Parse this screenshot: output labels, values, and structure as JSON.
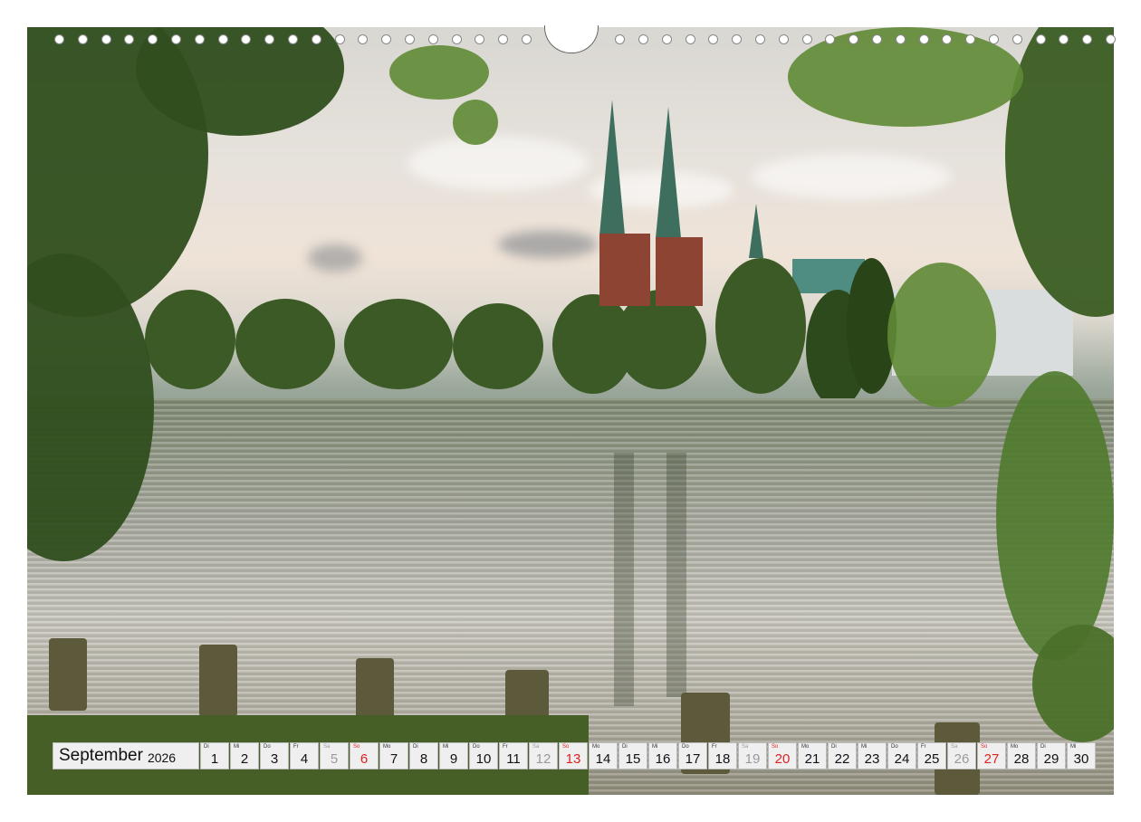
{
  "calendar": {
    "month": "September",
    "year": "2026",
    "days": [
      {
        "wd": "Di",
        "num": "1",
        "type": "weekday"
      },
      {
        "wd": "Mi",
        "num": "2",
        "type": "weekday"
      },
      {
        "wd": "Do",
        "num": "3",
        "type": "weekday"
      },
      {
        "wd": "Fr",
        "num": "4",
        "type": "weekday"
      },
      {
        "wd": "Sa",
        "num": "5",
        "type": "sat"
      },
      {
        "wd": "So",
        "num": "6",
        "type": "sun"
      },
      {
        "wd": "Mo",
        "num": "7",
        "type": "weekday"
      },
      {
        "wd": "Di",
        "num": "8",
        "type": "weekday"
      },
      {
        "wd": "Mi",
        "num": "9",
        "type": "weekday"
      },
      {
        "wd": "Do",
        "num": "10",
        "type": "weekday"
      },
      {
        "wd": "Fr",
        "num": "11",
        "type": "weekday"
      },
      {
        "wd": "Sa",
        "num": "12",
        "type": "sat"
      },
      {
        "wd": "So",
        "num": "13",
        "type": "sun"
      },
      {
        "wd": "Mo",
        "num": "14",
        "type": "weekday"
      },
      {
        "wd": "Di",
        "num": "15",
        "type": "weekday"
      },
      {
        "wd": "Mi",
        "num": "16",
        "type": "weekday"
      },
      {
        "wd": "Do",
        "num": "17",
        "type": "weekday"
      },
      {
        "wd": "Fr",
        "num": "18",
        "type": "weekday"
      },
      {
        "wd": "Sa",
        "num": "19",
        "type": "sat"
      },
      {
        "wd": "So",
        "num": "20",
        "type": "sun"
      },
      {
        "wd": "Mo",
        "num": "21",
        "type": "weekday"
      },
      {
        "wd": "Di",
        "num": "22",
        "type": "weekday"
      },
      {
        "wd": "Mi",
        "num": "23",
        "type": "weekday"
      },
      {
        "wd": "Do",
        "num": "24",
        "type": "weekday"
      },
      {
        "wd": "Fr",
        "num": "25",
        "type": "weekday"
      },
      {
        "wd": "Sa",
        "num": "26",
        "type": "sat"
      },
      {
        "wd": "So",
        "num": "27",
        "type": "sun"
      },
      {
        "wd": "Mo",
        "num": "28",
        "type": "weekday"
      },
      {
        "wd": "Di",
        "num": "29",
        "type": "weekday"
      },
      {
        "wd": "Mi",
        "num": "30",
        "type": "weekday"
      }
    ]
  },
  "colors": {
    "sunday": "#d22222",
    "saturday": "#9a9a9a"
  }
}
